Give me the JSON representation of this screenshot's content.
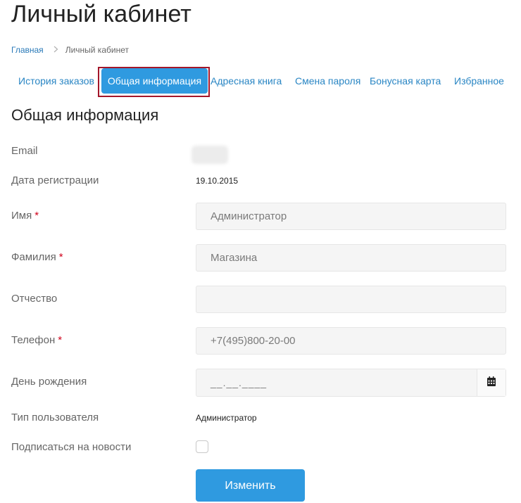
{
  "page_title": "Личный кабинет",
  "breadcrumb": {
    "home": "Главная",
    "separator": ">",
    "current": "Личный кабинет"
  },
  "tabs": [
    {
      "label": "История заказов"
    },
    {
      "label": "Общая информация",
      "active": true
    },
    {
      "label": "Адресная книга"
    },
    {
      "label": "Смена пароля"
    },
    {
      "label": "Бонусная карта"
    },
    {
      "label": "Избранное"
    }
  ],
  "section_title": "Общая информация",
  "form": {
    "email_label": "Email",
    "registration_label": "Дата регистрации",
    "registration_value": "19.10.2015",
    "first_name_label": "Имя",
    "first_name_value": "Администратор",
    "last_name_label": "Фамилия",
    "last_name_value": "Магазина",
    "middle_name_label": "Отчество",
    "middle_name_value": "",
    "phone_label": "Телефон",
    "phone_value": "+7(495)800-20-00",
    "birthday_label": "День рождения",
    "birthday_placeholder": "__.__.____",
    "user_type_label": "Тип пользователя",
    "user_type_value": "Администратор",
    "newsletter_label": "Подписаться на новости",
    "newsletter_checked": false,
    "required_mark": "*",
    "submit_label": "Изменить"
  },
  "icons": {
    "calendar": "calendar-icon",
    "breadcrumb_separator": "chevron-right-icon"
  },
  "colors": {
    "accent": "#2f9ae0",
    "link": "#2a86c4",
    "required": "#d0021b",
    "highlight_frame": "#a3162a"
  }
}
